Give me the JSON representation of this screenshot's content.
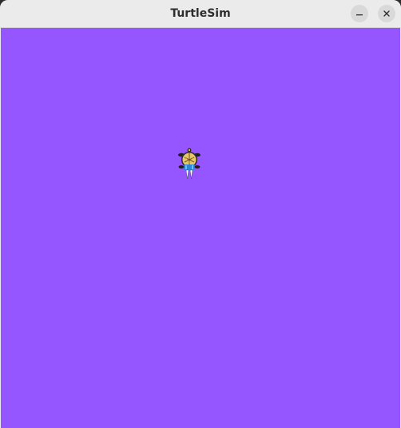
{
  "window": {
    "title": "TurtleSim",
    "minimize_icon": "minimize-icon",
    "close_icon": "close-icon"
  },
  "canvas": {
    "background_color": "#9656ff"
  },
  "turtle": {
    "icon": "turtle-icon",
    "heading": "down"
  }
}
